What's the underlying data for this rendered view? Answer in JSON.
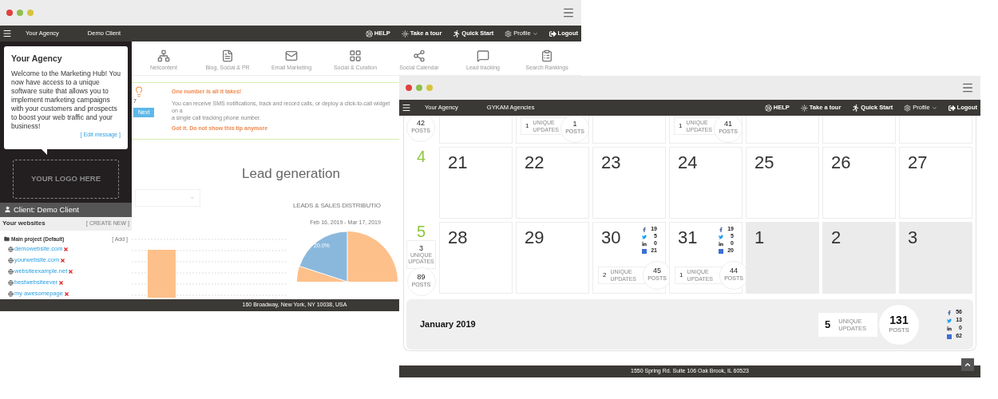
{
  "left_window": {
    "navbar": {
      "breadcrumbs": [
        "Your Agency",
        "Demo Client"
      ],
      "links": [
        {
          "kind": "help",
          "label": "HELP"
        },
        {
          "kind": "tour",
          "label": "Take a tour"
        },
        {
          "kind": "quickstart",
          "label": "Quick Start"
        },
        {
          "kind": "profile",
          "label": "Profile"
        },
        {
          "kind": "logout",
          "label": "Logout"
        }
      ]
    },
    "popover": {
      "title": "Your Agency",
      "text": "Welcome to the Marketing Hub! You now have access to a unique software suite that allows you to implement marketing campaigns with your customers and prospects to boost your web traffic and your business!",
      "link": "[ Edit message ]"
    },
    "logo_placeholder": "YOUR LOGO HERE",
    "client": "Client: Demo Client",
    "websites": {
      "title": "Your websites",
      "action": "[ CREATE NEW ]",
      "project": "Main project (Default)",
      "project_action": "[ Add ]",
      "sites": [
        "demowebsite.com",
        "yourwebsite.com",
        "websiteexample.net",
        "bestwebsiteever",
        "my awesomepage"
      ]
    },
    "tools": [
      {
        "kind": "network",
        "label": "Netcontent"
      },
      {
        "kind": "document",
        "label": "Blog, Social & PR"
      },
      {
        "kind": "mail",
        "label": "Email Marketing"
      },
      {
        "kind": "grid",
        "label": "Social & Curation"
      },
      {
        "kind": "share",
        "label": "Social Calendar"
      },
      {
        "kind": "chat",
        "label": "Lead tracking"
      },
      {
        "kind": "clipboard",
        "label": "Search Rankings"
      }
    ],
    "tip": {
      "counter": "7",
      "button": "Next",
      "title": "One number is all it takes!",
      "lines": [
        "You can receive SMS notifications, track and record calls, or deploy a click-to-call widget on a",
        "a single call tracking phone number."
      ],
      "dismiss": "Got it. Do not show this tip anymore"
    },
    "section_title": "Lead generation",
    "chart_title": "LEADS & SALES DISTRIBUTIO",
    "chart_subtitle": "Feb 16, 2019 - Mar 17, 2019",
    "pie_label": "20.0%",
    "footer": "160 Broadway, New York, NY 10038, USA"
  },
  "right_window": {
    "navbar": {
      "breadcrumbs": [
        "Your Agency",
        "GYKAM Agencies"
      ],
      "links": [
        {
          "kind": "help",
          "label": "HELP"
        },
        {
          "kind": "tour",
          "label": "Take a tour"
        },
        {
          "kind": "quickstart",
          "label": "Quick Start"
        },
        {
          "kind": "profile",
          "label": "Profile"
        },
        {
          "kind": "logout",
          "label": "Logout"
        }
      ]
    },
    "calendar": {
      "top_row": {
        "posts": "42",
        "posts_label": "POSTS",
        "days": [
          {
            "kind": "empty"
          },
          {
            "kind": "stats",
            "unique": "1",
            "unique_label": "UNIQUE UPDATES",
            "posts": "1",
            "posts_label": "POSTS"
          },
          {
            "kind": "empty"
          },
          {
            "kind": "stats",
            "unique": "1",
            "unique_label": "UNIQUE UPDATES",
            "posts": "41",
            "posts_label": "POSTS"
          },
          {
            "kind": "empty"
          },
          {
            "kind": "empty"
          },
          {
            "kind": "empty"
          }
        ]
      },
      "weeks": [
        {
          "number": "4",
          "days": [
            {
              "date": "21",
              "other_month": false
            },
            {
              "date": "22",
              "other_month": false
            },
            {
              "date": "23",
              "other_month": false
            },
            {
              "date": "24",
              "other_month": false
            },
            {
              "date": "25",
              "other_month": false
            },
            {
              "date": "26",
              "other_month": false
            },
            {
              "date": "27",
              "other_month": false
            }
          ]
        },
        {
          "number": "5",
          "unique": "3",
          "unique_label": "UNIQUE UPDATES",
          "posts": "89",
          "posts_label": "POSTS",
          "days": [
            {
              "date": "28",
              "other_month": false
            },
            {
              "date": "29",
              "other_month": false
            },
            {
              "date": "30",
              "other_month": false,
              "social": [
                {
                  "kind": "facebook",
                  "count": "19"
                },
                {
                  "kind": "twitter",
                  "count": "5"
                },
                {
                  "kind": "linkedin",
                  "count": "0"
                },
                {
                  "kind": "other",
                  "count": "21"
                }
              ],
              "unique": "2",
              "unique_label": "UNIQUE UPDATES",
              "posts": "45",
              "posts_label": "POSTS"
            },
            {
              "date": "31",
              "other_month": false,
              "social": [
                {
                  "kind": "facebook",
                  "count": "19"
                },
                {
                  "kind": "twitter",
                  "count": "5"
                },
                {
                  "kind": "linkedin",
                  "count": "0"
                },
                {
                  "kind": "other",
                  "count": "20"
                }
              ],
              "unique": "1",
              "unique_label": "UNIQUE UPDATES",
              "posts": "44",
              "posts_label": "POSTS"
            },
            {
              "date": "1",
              "other_month": true
            },
            {
              "date": "2",
              "other_month": true
            },
            {
              "date": "3",
              "other_month": true
            }
          ]
        }
      ],
      "summary": {
        "month": "January 2019",
        "unique": "5",
        "unique_label": "UNIQUE UPDATES",
        "posts": "131",
        "posts_label": "POSTS",
        "social": [
          {
            "kind": "facebook",
            "count": "56"
          },
          {
            "kind": "twitter",
            "count": "13"
          },
          {
            "kind": "linkedin",
            "count": "0"
          },
          {
            "kind": "other",
            "count": "62"
          }
        ]
      }
    },
    "footer": "1550 Spring Rd. Suite 106 Oak Brook, IL  60523"
  }
}
